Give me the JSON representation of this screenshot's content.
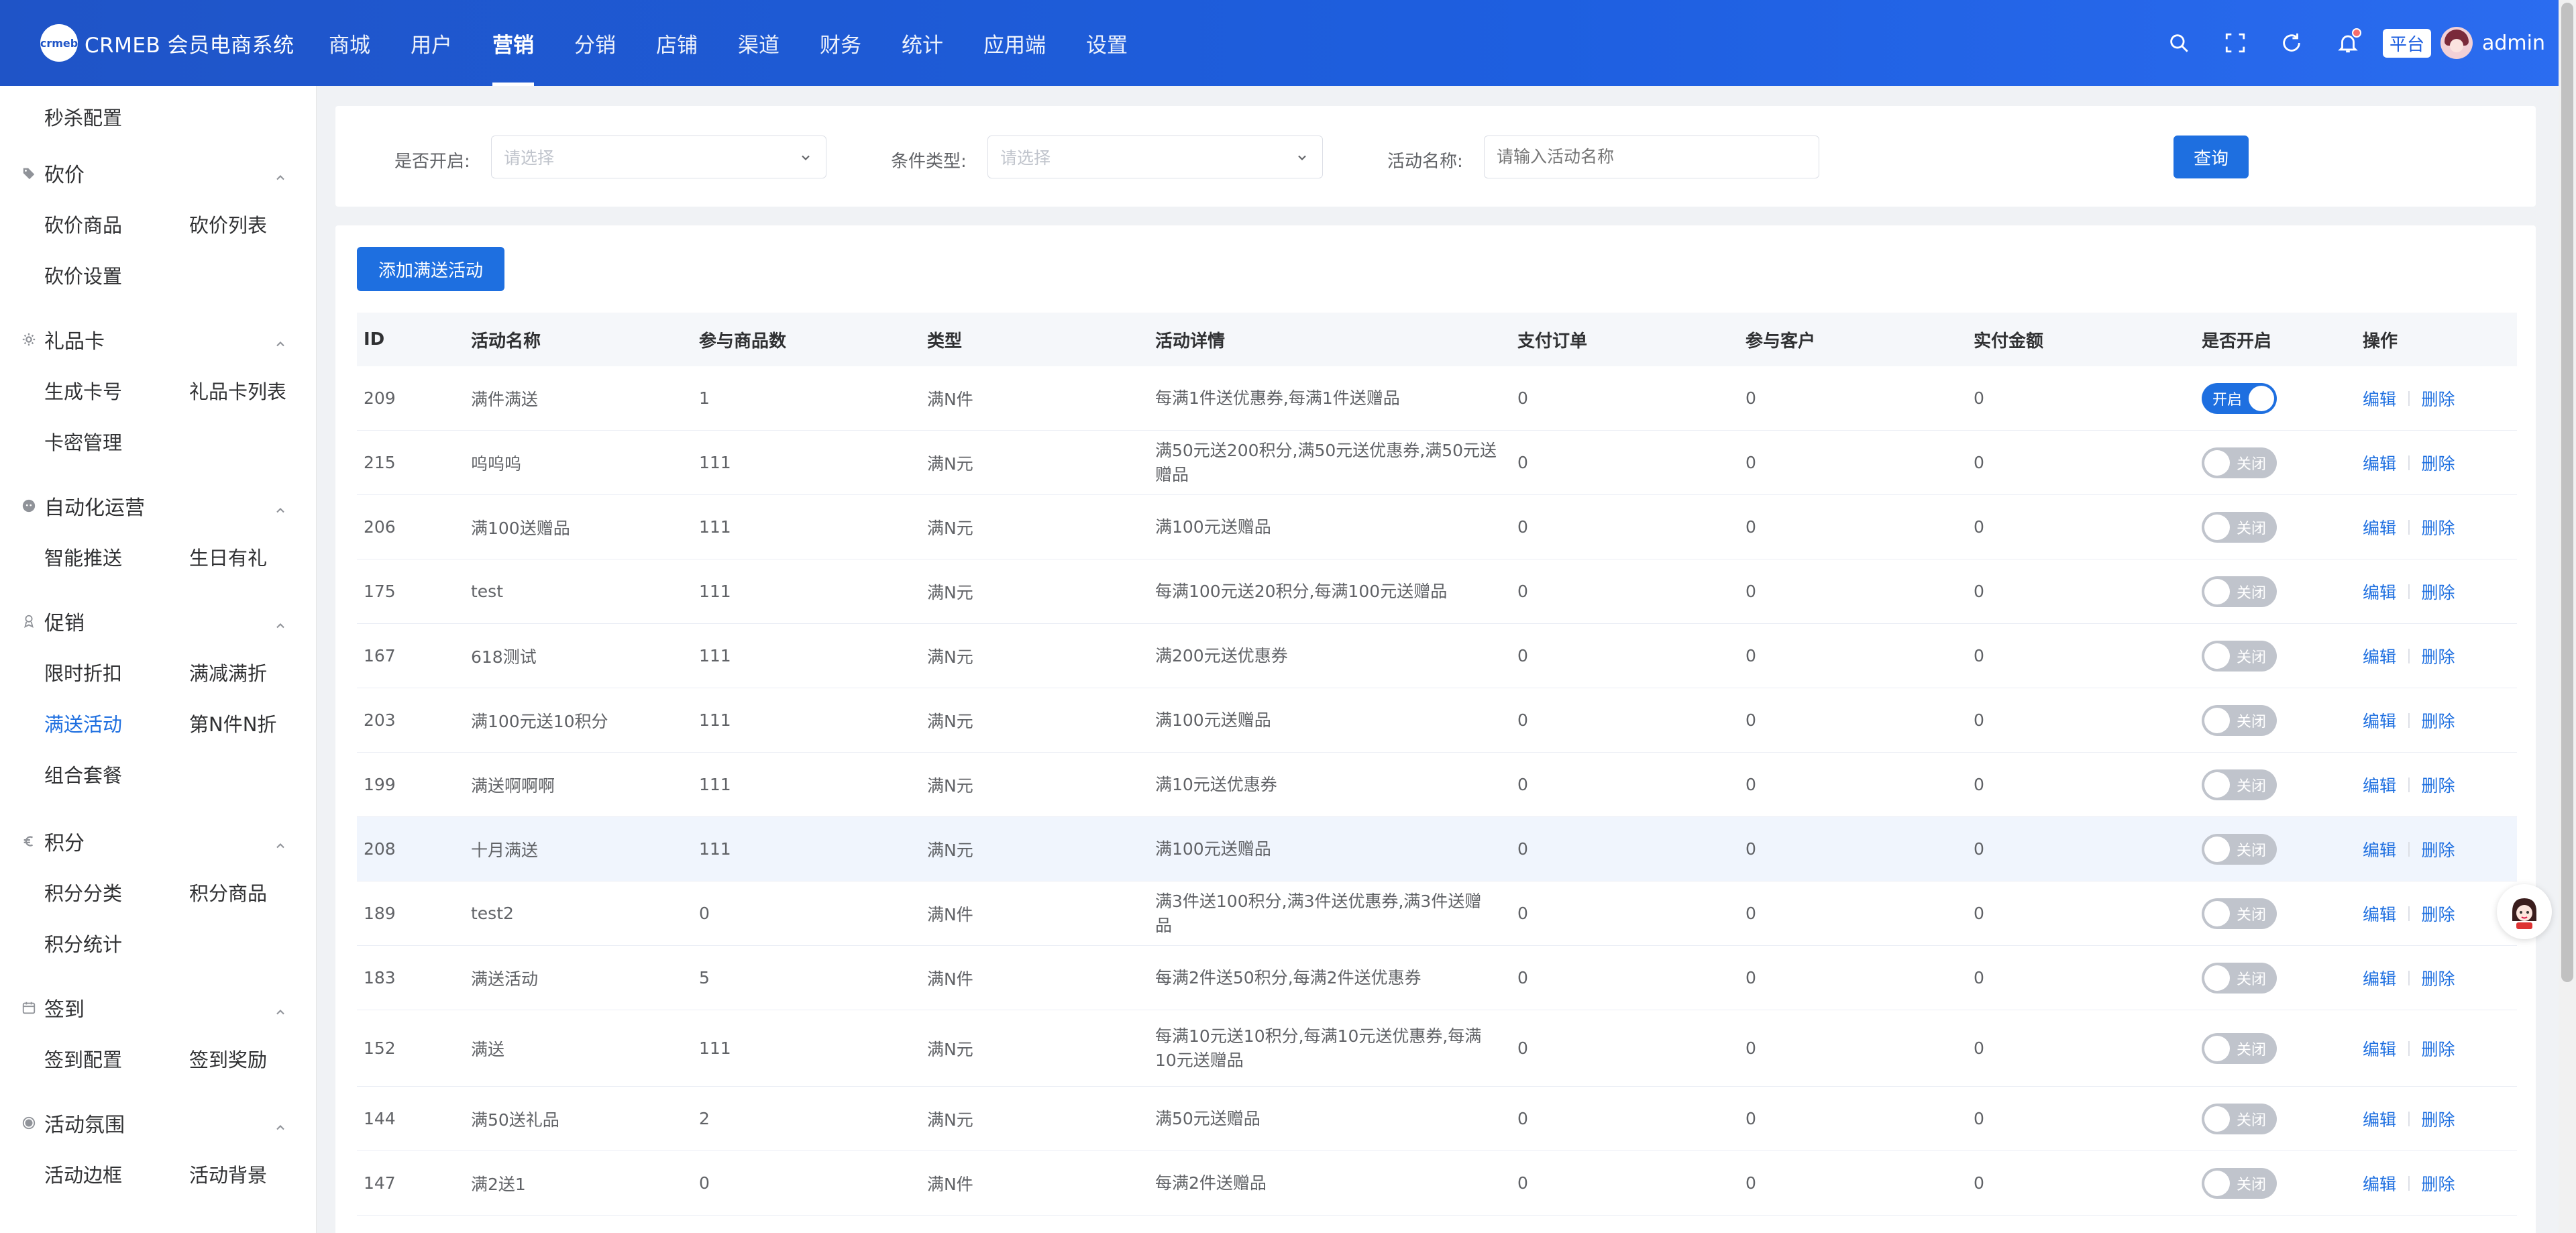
{
  "app": {
    "logo_text": "crmeb",
    "title": "CRMEB 会员电商系统"
  },
  "topnav": [
    {
      "label": "商城"
    },
    {
      "label": "用户"
    },
    {
      "label": "营销"
    },
    {
      "label": "分销"
    },
    {
      "label": "店铺"
    },
    {
      "label": "渠道"
    },
    {
      "label": "财务"
    },
    {
      "label": "统计"
    },
    {
      "label": "应用端"
    },
    {
      "label": "设置"
    }
  ],
  "topnav_active": "营销",
  "topbar": {
    "platform": "平台",
    "user": "admin"
  },
  "sidebar": {
    "top_item": "秒杀配置",
    "groups": [
      {
        "title": "砍价",
        "icon": "tag-icon",
        "items": [
          "砍价商品",
          "砍价列表",
          "砍价设置"
        ]
      },
      {
        "title": "礼品卡",
        "icon": "gear-icon",
        "items": [
          "生成卡号",
          "礼品卡列表",
          "卡密管理"
        ]
      },
      {
        "title": "自动化运营",
        "icon": "robot-icon",
        "items": [
          "智能推送",
          "生日有礼"
        ]
      },
      {
        "title": "促销",
        "icon": "gift-icon",
        "items": [
          "限时折扣",
          "满减满折",
          "满送活动",
          "第N件N折",
          "组合套餐"
        ]
      },
      {
        "title": "积分",
        "icon": "euro-icon",
        "items": [
          "积分分类",
          "积分商品",
          "积分统计"
        ]
      },
      {
        "title": "签到",
        "icon": "calendar-icon",
        "items": [
          "签到配置",
          "签到奖励"
        ]
      },
      {
        "title": "活动氛围",
        "icon": "circle-icon",
        "items": [
          "活动边框",
          "活动背景"
        ]
      }
    ],
    "active_item": "满送活动"
  },
  "filters": {
    "enabled_label": "是否开启:",
    "enabled_placeholder": "请选择",
    "condition_label": "条件类型:",
    "condition_placeholder": "请选择",
    "name_label": "活动名称:",
    "name_placeholder": "请输入活动名称",
    "query_button": "查询"
  },
  "table": {
    "add_button": "添加满送活动",
    "columns": [
      "ID",
      "活动名称",
      "参与商品数",
      "类型",
      "活动详情",
      "支付订单",
      "参与客户",
      "实付金额",
      "是否开启",
      "操作"
    ],
    "switch_on": "开启",
    "switch_off": "关闭",
    "edit": "编辑",
    "delete": "删除",
    "rows": [
      {
        "id": "209",
        "name": "满件满送",
        "count": "1",
        "type": "满N件",
        "detail": "每满1件送优惠券,每满1件送赠品",
        "orders": "0",
        "customers": "0",
        "amount": "0",
        "enabled": true
      },
      {
        "id": "215",
        "name": "呜呜呜",
        "count": "111",
        "type": "满N元",
        "detail": "满50元送200积分,满50元送优惠券,满50元送赠品",
        "orders": "0",
        "customers": "0",
        "amount": "0",
        "enabled": false
      },
      {
        "id": "206",
        "name": "满100送赠品",
        "count": "111",
        "type": "满N元",
        "detail": "满100元送赠品",
        "orders": "0",
        "customers": "0",
        "amount": "0",
        "enabled": false
      },
      {
        "id": "175",
        "name": "test",
        "count": "111",
        "type": "满N元",
        "detail": "每满100元送20积分,每满100元送赠品",
        "orders": "0",
        "customers": "0",
        "amount": "0",
        "enabled": false
      },
      {
        "id": "167",
        "name": "618测试",
        "count": "111",
        "type": "满N元",
        "detail": "满200元送优惠券",
        "orders": "0",
        "customers": "0",
        "amount": "0",
        "enabled": false
      },
      {
        "id": "203",
        "name": "满100元送10积分",
        "count": "111",
        "type": "满N元",
        "detail": "满100元送赠品",
        "orders": "0",
        "customers": "0",
        "amount": "0",
        "enabled": false
      },
      {
        "id": "199",
        "name": "满送啊啊啊",
        "count": "111",
        "type": "满N元",
        "detail": "满10元送优惠券",
        "orders": "0",
        "customers": "0",
        "amount": "0",
        "enabled": false
      },
      {
        "id": "208",
        "name": "十月满送",
        "count": "111",
        "type": "满N元",
        "detail": "满100元送赠品",
        "orders": "0",
        "customers": "0",
        "amount": "0",
        "enabled": false
      },
      {
        "id": "189",
        "name": "test2",
        "count": "0",
        "type": "满N件",
        "detail": "满3件送100积分,满3件送优惠券,满3件送赠品",
        "orders": "0",
        "customers": "0",
        "amount": "0",
        "enabled": false
      },
      {
        "id": "183",
        "name": "满送活动",
        "count": "5",
        "type": "满N件",
        "detail": "每满2件送50积分,每满2件送优惠券",
        "orders": "0",
        "customers": "0",
        "amount": "0",
        "enabled": false
      },
      {
        "id": "152",
        "name": "满送",
        "count": "111",
        "type": "满N元",
        "detail": "每满10元送10积分,每满10元送优惠券,每满10元送赠品",
        "orders": "0",
        "customers": "0",
        "amount": "0",
        "enabled": false
      },
      {
        "id": "144",
        "name": "满50送礼品",
        "count": "2",
        "type": "满N元",
        "detail": "满50元送赠品",
        "orders": "0",
        "customers": "0",
        "amount": "0",
        "enabled": false
      },
      {
        "id": "147",
        "name": "满2送1",
        "count": "0",
        "type": "满N件",
        "detail": "每满2件送赠品",
        "orders": "0",
        "customers": "0",
        "amount": "0",
        "enabled": false
      }
    ]
  },
  "colors": {
    "primary": "#1e6fe0",
    "topbar": "#1f54c7",
    "switch_off": "#c0c4cc"
  }
}
